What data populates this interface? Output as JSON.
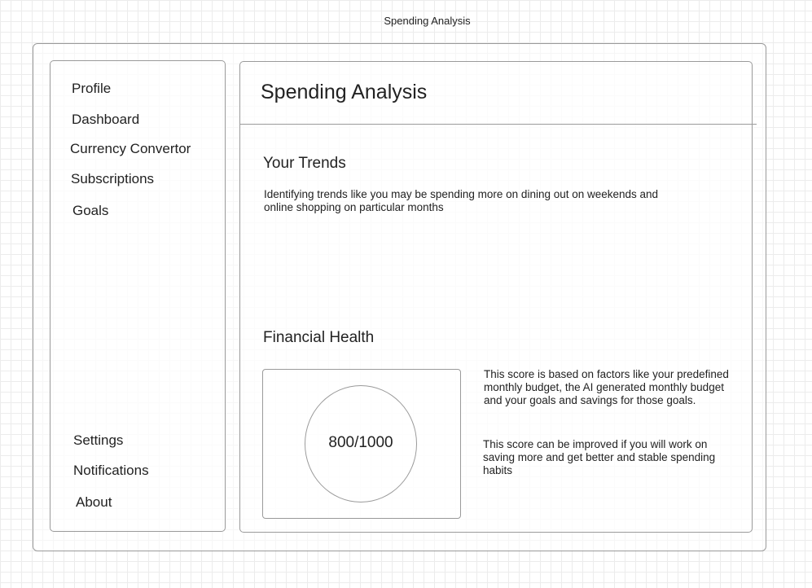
{
  "window": {
    "title": "Spending Analysis"
  },
  "sidebar": {
    "top_items": [
      {
        "label": "Profile"
      },
      {
        "label": "Dashboard"
      },
      {
        "label": "Currency Convertor"
      },
      {
        "label": "Subscriptions"
      },
      {
        "label": "Goals"
      }
    ],
    "bottom_items": [
      {
        "label": "Settings"
      },
      {
        "label": "Notifications"
      },
      {
        "label": "About"
      }
    ]
  },
  "main": {
    "title": "Spending Analysis",
    "trends": {
      "title": "Your Trends",
      "description": "Identifying trends like you may be spending more on dining out on weekends and online shopping on particular months"
    },
    "financial_health": {
      "title": "Financial Health",
      "score": "800/1000",
      "description_1": "This score is based on factors like your predefined monthly budget, the AI generated monthly budget and your goals and savings for those goals.",
      "description_2": "This score can be improved if you will work on saving more and get better and stable spending habits"
    }
  }
}
